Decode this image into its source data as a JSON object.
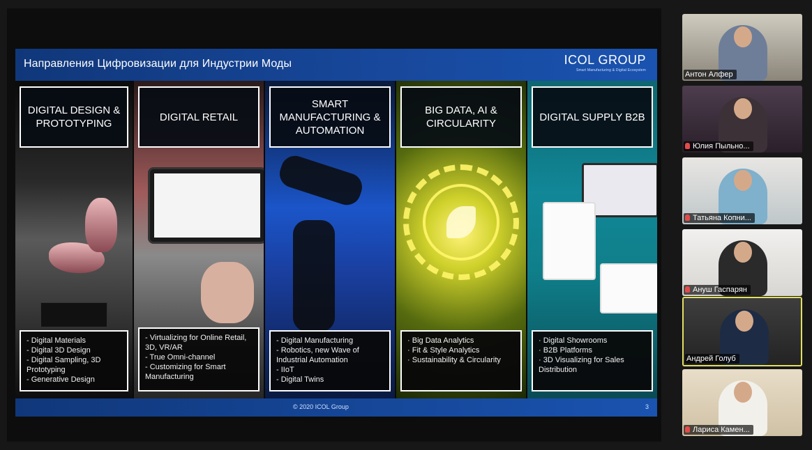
{
  "slide": {
    "title": "Направления Цифровизации для Индустрии Моды",
    "brand": {
      "name": "ICOL GROUP",
      "tagline": "Smart Manufacturing & Digital Ecosystem"
    },
    "columns": [
      {
        "title": "DIGITAL DESIGN & PROTOTYPING",
        "items": [
          "Digital Materials",
          "Digital 3D Design",
          "Digital Sampling, 3D Prototyping",
          "Generative Design"
        ]
      },
      {
        "title": "DIGITAL RETAIL",
        "items": [
          "Virtualizing for Online Retail, 3D, VR/AR",
          "True Omni-channel",
          "Customizing for Smart Manufacturing"
        ]
      },
      {
        "title": "SMART MANUFACTURING & AUTOMATION",
        "items": [
          "Digital Manufacturing",
          "Robotics, new Wave of Industrial Automation",
          "IIoT",
          "Digital Twins"
        ]
      },
      {
        "title": "BIG DATA, AI & CIRCULARITY",
        "items": [
          "Big Data Analytics",
          "Fit & Style Analytics",
          "Sustainability & Circularity"
        ]
      },
      {
        "title": "DIGITAL SUPPLY B2B",
        "items": [
          "Digital Showrooms",
          "B2B Platforms",
          "3D Visualizing for Sales Distribution"
        ]
      }
    ],
    "footer": {
      "copyright": "©  2020    ICOL Group",
      "page_number": "3"
    }
  },
  "participants": [
    {
      "name": "Антон Алфер",
      "muted": false,
      "active": false
    },
    {
      "name": "Юлия Пыльно...",
      "muted": true,
      "active": false
    },
    {
      "name": "Татьяна Копни...",
      "muted": true,
      "active": false
    },
    {
      "name": "Ануш Гаспарян",
      "muted": true,
      "active": false
    },
    {
      "name": "Андрей Голуб",
      "muted": false,
      "active": true
    },
    {
      "name": "Лариса Камен...",
      "muted": true,
      "active": false
    }
  ],
  "colors": {
    "header_blue": "#17479a",
    "active_border": "#e3e061",
    "mic_muted": "#e34b4b"
  }
}
